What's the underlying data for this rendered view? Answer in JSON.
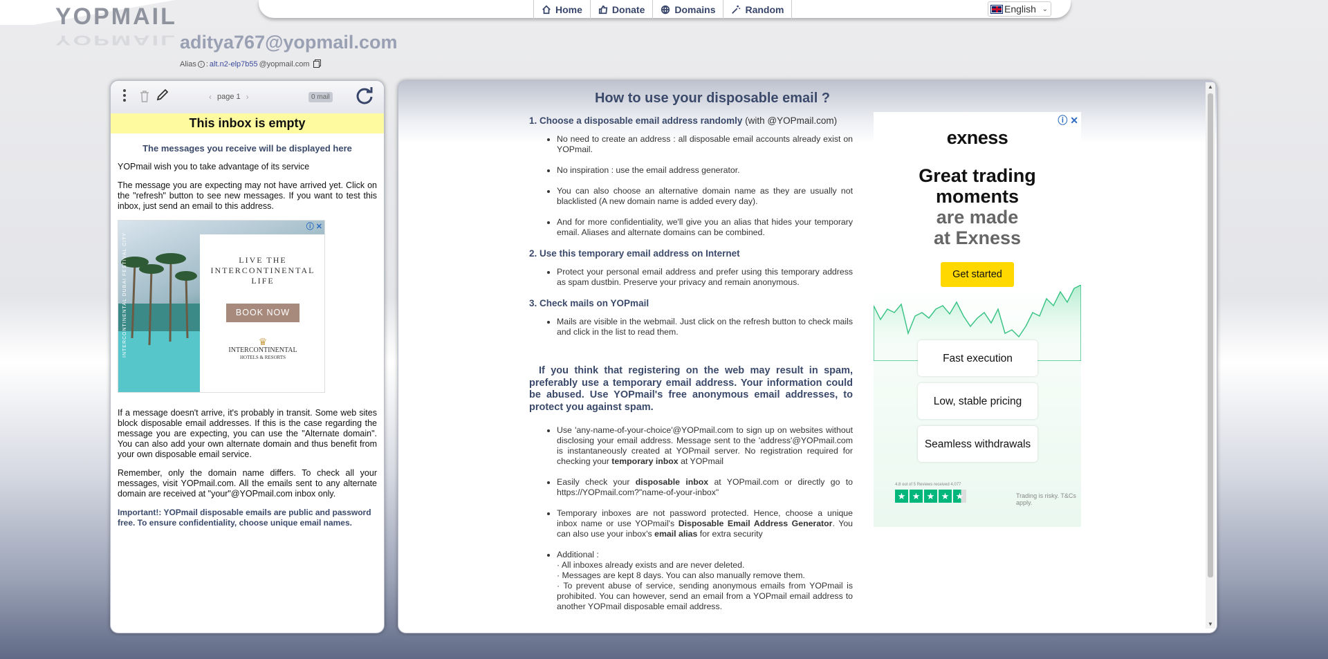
{
  "logo": {
    "text": "YOPMAIL"
  },
  "nav": {
    "items": [
      {
        "label": "Home",
        "icon": "home-icon"
      },
      {
        "label": "Donate",
        "icon": "thumbs-up-icon"
      },
      {
        "label": "Domains",
        "icon": "globe-icon"
      },
      {
        "label": "Random",
        "icon": "magic-wand-icon"
      }
    ],
    "language": "English"
  },
  "inbox": {
    "email": "aditya767@yopmail.com",
    "alias_label": "Alias",
    "alias_sep": ":",
    "alias_value": "alt.n2-elp7b55",
    "alias_domain": "@yopmail.com"
  },
  "toolbar": {
    "page_label": "page 1",
    "mail_count": "0 mail"
  },
  "left": {
    "empty_title": "This inbox is empty",
    "subtitle": "The messages you receive will be displayed here",
    "p1": "YOPmail wish you to take advantage of its service",
    "p2": "The message you are expecting may not have arrived yet. Click on the \"refresh\" button to see new messages. If you want to test this inbox, just send an email to this address.",
    "p3": "If a message doesn't arrive, it's probably in transit. Some web sites block disposable email addresses. If this is the case regarding the message you are expecting, you can use the \"Alternate domain\". You can also add your own alternate domain and thus benefit from your own disposable email service.",
    "p4": "Remember, only the domain name differs. To check all your messages, visit YOPmail.com. All the emails sent to any alternate domain are received at \"your\"@YOPmail.com inbox only.",
    "important": "Important!: YOPmail disposable emails are public and password free. To ensure confidentiality, choose unique email names."
  },
  "ad_left": {
    "tagline": "LIVE THE INTERCONTINENTAL LIFE",
    "button": "BOOK NOW",
    "brand": "INTERCONTINENTAL",
    "brand_sub": "HOTELS & RESORTS",
    "vertical": "INTERCONTINENTAL DUBAI FESTIVAL CITY"
  },
  "howto": {
    "title": "How to use your disposable email ?",
    "s1_title": "1. Choose a disposable email address randomly",
    "s1_suffix": "(with @YOPmail.com)",
    "s1_items": [
      "No need to create an address : all disposable email accounts already exist on YOPmail.",
      "No inspiration : use the email address generator.",
      "You can also choose an alternative domain name as they are usually not blacklisted (A new domain name is added every day).",
      "And for more confidentiality, we'll give you an alias that hides your temporary email. Aliases and alternate domains can be combined."
    ],
    "s2_title": "2. Use this temporary email address on Internet",
    "s2_items": [
      "Protect your personal email address and prefer using this temporary address as spam dustbin. Preserve your privacy and remain anonymous."
    ],
    "s3_title": "3. Check mails on YOPmail",
    "s3_items": [
      "Mails are visible in the webmail. Just click on the refresh button to check mails and click in the list to read them."
    ],
    "big": "If you think that registering on the web may result in spam, preferably use a temporary email address. Your information could be abused. Use YOPmail's free anonymous email addresses, to protect you against spam.",
    "b1": "Use 'any-name-of-your-choice'@YOPmail.com to sign up on websites without disclosing your email address. Message sent to the 'address'@YOPmail.com is instantaneously created at YOPmail server. No registration required for checking your",
    "b1_bold": "temporary inbox",
    "b1_end": "at YOPmail",
    "b2_a": "Easily check your",
    "b2_bold": "disposable inbox",
    "b2_b": "at YOPmail.com or directly go to https://YOPmail.com?\"name-of-your-inbox\"",
    "b3_a": "Temporary inboxes are not password protected. Hence, choose a unique inbox name or use YOPmail's",
    "b3_bold": "Disposable Email Address Generator",
    "b3_b": ". You can also use your inbox's",
    "b3_bold2": "email alias",
    "b3_c": "for extra security",
    "b4_title": "Additional :",
    "b4_l1": "· All inboxes already exists and are never deleted.",
    "b4_l2": "· Messages are kept 8 days. You can also manually remove them.",
    "b4_l3": "· To prevent abuse of service, sending anonymous emails from YOPmail is prohibited. You can however, send an email from a YOPmail email address to another YOPmail disposable email address."
  },
  "ad_right": {
    "brand": "exness",
    "h1": "Great trading",
    "h2": "moments",
    "h3": "are made",
    "h4": "at Exness",
    "cta": "Get started",
    "f1": "Fast execution",
    "f2": "Low, stable pricing",
    "f3": "Seamless withdrawals",
    "trust": "4.8 out of 5 Reviews received 4,077",
    "risk": "Trading is risky. T&Cs apply."
  }
}
